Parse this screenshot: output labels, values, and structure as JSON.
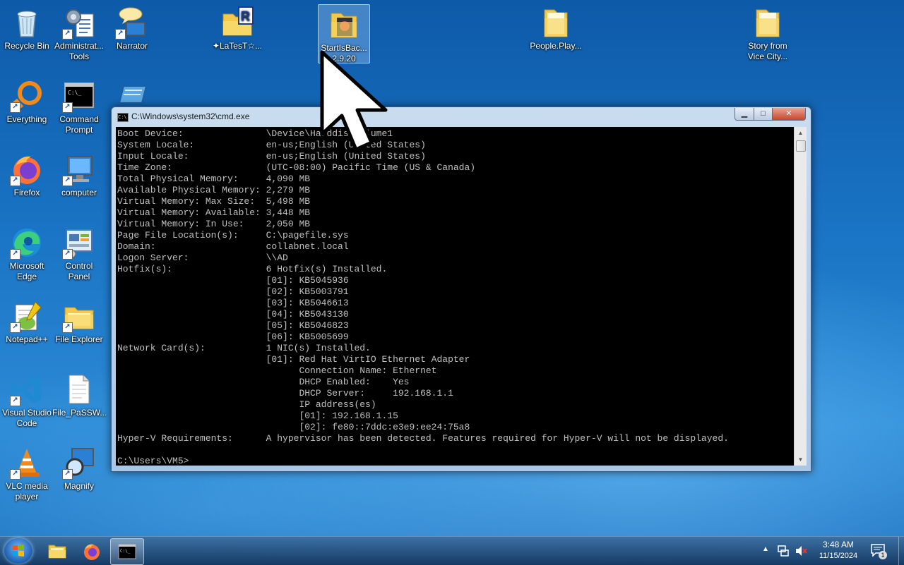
{
  "desktop": {
    "icons": [
      {
        "label": "Recycle Bin"
      },
      {
        "label": "Administrative Tools",
        "display": "Administrat...\nTools"
      },
      {
        "label": "Narrator"
      },
      {
        "label": "✦LaTesT☆..."
      },
      {
        "label": "StartIsBack 2.9.20",
        "display": "StartIsBac...\n2.9.20"
      },
      {
        "label": "People.Play..."
      },
      {
        "label": "Story from Vice City...",
        "display": "Story from\nVice City..."
      },
      {
        "label": "Everything"
      },
      {
        "label": "Command Prompt",
        "display": "Command\nPrompt"
      },
      {
        "label": "Firefox"
      },
      {
        "label": "computer"
      },
      {
        "label": "Microsoft Edge",
        "display": "Microsoft\nEdge"
      },
      {
        "label": "Control Panel",
        "display": "Control\nPanel"
      },
      {
        "label": "Notepad++"
      },
      {
        "label": "File Explorer"
      },
      {
        "label": "Visual Studio Code",
        "display": "Visual Studio\nCode"
      },
      {
        "label": "File_PaSSW...",
        "display": "File_PaSSW..."
      },
      {
        "label": "VLC media player",
        "display": "VLC media\nplayer"
      },
      {
        "label": "Magnify"
      }
    ]
  },
  "cmd_window": {
    "title": "C:\\Windows\\system32\\cmd.exe",
    "min": "▁",
    "max": "□",
    "close": "✕",
    "lines": [
      "Boot Device:               \\Device\\HarddiskVolume1",
      "System Locale:             en-us;English (United States)",
      "Input Locale:              en-us;English (United States)",
      "Time Zone:                 (UTC-08:00) Pacific Time (US & Canada)",
      "Total Physical Memory:     4,090 MB",
      "Available Physical Memory: 2,279 MB",
      "Virtual Memory: Max Size:  5,498 MB",
      "Virtual Memory: Available: 3,448 MB",
      "Virtual Memory: In Use:    2,050 MB",
      "Page File Location(s):     C:\\pagefile.sys",
      "Domain:                    collabnet.local",
      "Logon Server:              \\\\AD",
      "Hotfix(s):                 6 Hotfix(s) Installed.",
      "                           [01]: KB5045936",
      "                           [02]: KB5003791",
      "                           [03]: KB5046613",
      "                           [04]: KB5043130",
      "                           [05]: KB5046823",
      "                           [06]: KB5005699",
      "Network Card(s):           1 NIC(s) Installed.",
      "                           [01]: Red Hat VirtIO Ethernet Adapter",
      "                                 Connection Name: Ethernet",
      "                                 DHCP Enabled:    Yes",
      "                                 DHCP Server:     192.168.1.1",
      "                                 IP address(es)",
      "                                 [01]: 192.168.1.15",
      "                                 [02]: fe80::7ddc:e3e9:ee24:75a8",
      "Hyper-V Requirements:      A hypervisor has been detected. Features required for Hyper-V will not be displayed.",
      "",
      "C:\\Users\\VM5>"
    ]
  },
  "taskbar": {
    "time": "3:48 AM",
    "date": "11/15/2024",
    "notification_count": "1",
    "tray_chevron": "▲"
  },
  "colors": {
    "console_bg": "#000000",
    "console_fg": "#c0c0c0",
    "close_btn": "#c8462c"
  }
}
